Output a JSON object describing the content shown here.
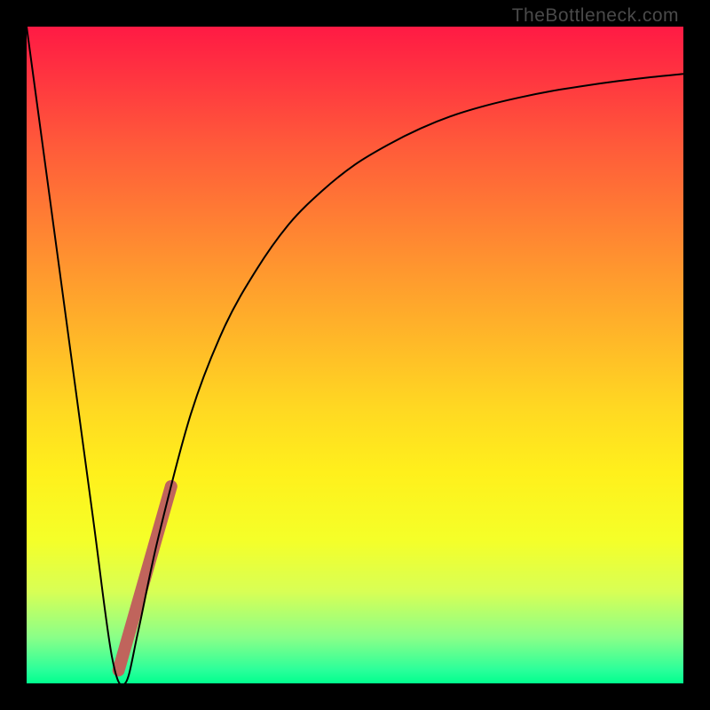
{
  "watermark": {
    "text": "TheBottleneck.com"
  },
  "colors": {
    "background": "#000000",
    "curve": "#000000",
    "highlight": "#c0645c",
    "gradient_top": "#ff1a44",
    "gradient_bottom": "#01ff8e"
  },
  "chart_data": {
    "type": "line",
    "title": "",
    "xlabel": "",
    "ylabel": "",
    "xlim": [
      0,
      100
    ],
    "ylim": [
      0,
      100
    ],
    "series": [
      {
        "name": "main-curve",
        "x": [
          0,
          5,
          10,
          13,
          15,
          17,
          20,
          25,
          30,
          35,
          40,
          45,
          50,
          55,
          60,
          65,
          70,
          75,
          80,
          85,
          90,
          95,
          100
        ],
        "values": [
          100,
          63,
          26,
          4,
          0,
          8,
          22,
          41,
          54,
          63,
          70,
          75,
          79,
          82,
          84.5,
          86.5,
          88,
          89.2,
          90.2,
          91,
          91.7,
          92.3,
          92.8
        ]
      },
      {
        "name": "highlight-segment",
        "x": [
          14,
          22
        ],
        "values": [
          2,
          30
        ]
      }
    ]
  }
}
